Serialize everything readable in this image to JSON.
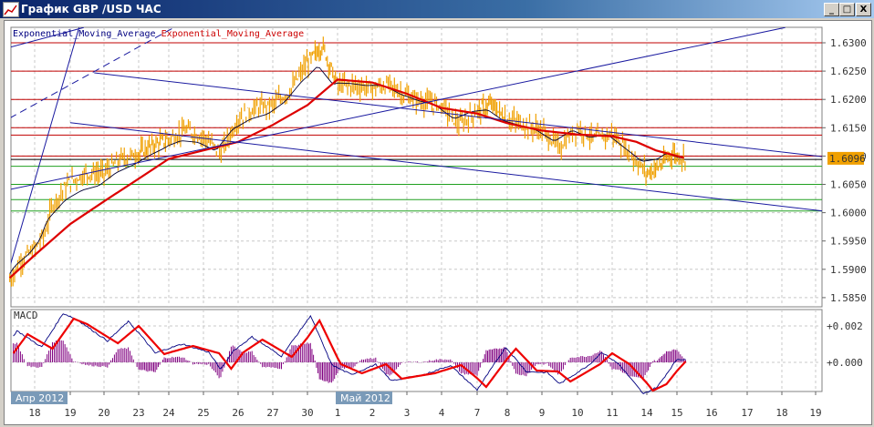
{
  "window": {
    "title": "График GBP /USD  ЧАС",
    "minimize": "_",
    "maximize": "□",
    "close": "X"
  },
  "legend": [
    {
      "label": "Exponential_Moving_Average",
      "color": "#000080"
    },
    {
      "label": "Exponential_Moving_Average",
      "color": "#cc0000"
    }
  ],
  "macd_label": "MACD",
  "current_price_label": "1.6096",
  "chart_data": {
    "type": "line",
    "title": "График GBP /USD  ЧАС",
    "x_ticks": [
      "18",
      "19",
      "20",
      "23",
      "24",
      "25",
      "26",
      "27",
      "30",
      "1",
      "2",
      "3",
      "4",
      "7",
      "8",
      "9",
      "10",
      "11",
      "14",
      "15",
      "16",
      "17",
      "18",
      "19"
    ],
    "month_labels": [
      {
        "label": "Апр 2012",
        "at_index": -0.7
      },
      {
        "label": "Май 2012",
        "at_index": 9
      }
    ],
    "price_axis": {
      "ticks": [
        "1.6300",
        "1.6250",
        "1.6200",
        "1.6150",
        "1.6100",
        "1.6050",
        "1.6000",
        "1.5950",
        "1.5900",
        "1.5850"
      ],
      "ylim": [
        1.5825,
        1.6325
      ]
    },
    "macd_axis": {
      "ticks": [
        "+0.002",
        "+0.000"
      ],
      "ylim": [
        -0.002,
        0.0027
      ]
    },
    "current_price": 1.6096,
    "price_series": {
      "name": "GBP/USD close",
      "color": "#f0a000",
      "points": [
        [
          -0.7,
          1.588
        ],
        [
          -0.4,
          1.5915
        ],
        [
          0,
          1.5935
        ],
        [
          0.3,
          1.5965
        ],
        [
          0.5,
          1.6015
        ],
        [
          1,
          1.6055
        ],
        [
          1.5,
          1.607
        ],
        [
          2,
          1.607
        ],
        [
          2.5,
          1.6095
        ],
        [
          3,
          1.6105
        ],
        [
          3.5,
          1.612
        ],
        [
          4,
          1.613
        ],
        [
          4.5,
          1.6145
        ],
        [
          5,
          1.6135
        ],
        [
          5.5,
          1.6105
        ],
        [
          6,
          1.6165
        ],
        [
          6.5,
          1.6185
        ],
        [
          7,
          1.619
        ],
        [
          7.5,
          1.6215
        ],
        [
          8,
          1.6265
        ],
        [
          8.5,
          1.6295
        ],
        [
          9,
          1.6225
        ],
        [
          9.5,
          1.6225
        ],
        [
          10,
          1.622
        ],
        [
          10.5,
          1.6225
        ],
        [
          11,
          1.6205
        ],
        [
          11.5,
          1.6195
        ],
        [
          12,
          1.619
        ],
        [
          12.5,
          1.6155
        ],
        [
          13,
          1.618
        ],
        [
          13.5,
          1.619
        ],
        [
          14,
          1.6165
        ],
        [
          14.5,
          1.6155
        ],
        [
          15,
          1.6145
        ],
        [
          15.5,
          1.6115
        ],
        [
          16,
          1.615
        ],
        [
          16.5,
          1.613
        ],
        [
          17,
          1.614
        ],
        [
          17.5,
          1.6105
        ],
        [
          18,
          1.607
        ],
        [
          18.5,
          1.6085
        ],
        [
          18.8,
          1.6105
        ],
        [
          19.2,
          1.6096
        ]
      ]
    },
    "ema_series": {
      "name": "Exponential_Moving_Average",
      "color": "#dd0000",
      "points": [
        [
          -0.7,
          1.5885
        ],
        [
          0,
          1.5925
        ],
        [
          1,
          1.598
        ],
        [
          2,
          1.602
        ],
        [
          3,
          1.606
        ],
        [
          4,
          1.6095
        ],
        [
          5,
          1.611
        ],
        [
          6,
          1.6125
        ],
        [
          7,
          1.6155
        ],
        [
          8,
          1.619
        ],
        [
          9,
          1.6235
        ],
        [
          10,
          1.623
        ],
        [
          11,
          1.621
        ],
        [
          12,
          1.6185
        ],
        [
          13,
          1.6175
        ],
        [
          14,
          1.6158
        ],
        [
          15,
          1.6145
        ],
        [
          16,
          1.6138
        ],
        [
          17,
          1.6135
        ],
        [
          17.7,
          1.6125
        ],
        [
          18.3,
          1.611
        ],
        [
          19.2,
          1.6097
        ]
      ]
    },
    "hlines": [
      {
        "price": 1.63,
        "color": "#c00000"
      },
      {
        "price": 1.625,
        "color": "#c00000"
      },
      {
        "price": 1.62,
        "color": "#c00000"
      },
      {
        "price": 1.615,
        "color": "#c00000"
      },
      {
        "price": 1.6137,
        "color": "#c00000"
      },
      {
        "price": 1.61,
        "color": "#c00000"
      },
      {
        "price": 1.6094,
        "color": "#000000"
      },
      {
        "price": 1.6082,
        "color": "#20a020"
      },
      {
        "price": 1.605,
        "color": "#20a020"
      },
      {
        "price": 1.6023,
        "color": "#20a020"
      },
      {
        "price": 1.6003,
        "color": "#20a020"
      }
    ],
    "trendlines": [
      {
        "from": [
          -0.7,
          1.6041
        ],
        "to": [
          22.1,
          1.6327
        ],
        "dashed": false
      },
      {
        "from": [
          1.71,
          1.6247
        ],
        "to": [
          23.2,
          1.6099
        ],
        "dashed": false
      },
      {
        "from": [
          1.0,
          1.6159
        ],
        "to": [
          23.2,
          1.6003
        ],
        "dashed": false
      },
      {
        "from": [
          -0.7,
          1.5904
        ],
        "to": [
          1.26,
          1.6327
        ],
        "dashed": false
      },
      {
        "from": [
          -0.7,
          1.6167
        ],
        "to": [
          4.15,
          1.6327
        ],
        "dashed": true
      },
      {
        "from": [
          -0.7,
          1.6292
        ],
        "to": [
          1.4,
          1.6327
        ],
        "dashed": false
      }
    ],
    "macd_signal": {
      "name": "Signal",
      "color": "#ee0000",
      "points": [
        [
          -0.6,
          0.0005
        ],
        [
          -0.2,
          0.00155
        ],
        [
          0.5,
          0.00075
        ],
        [
          1.1,
          0.0024
        ],
        [
          1.5,
          0.0021
        ],
        [
          2.4,
          0.00105
        ],
        [
          3,
          0.002
        ],
        [
          3.85,
          0.00045
        ],
        [
          4.7,
          0.0009
        ],
        [
          5.45,
          0.0005
        ],
        [
          5.8,
          -0.00035
        ],
        [
          6.15,
          0.00055
        ],
        [
          6.7,
          0.00125
        ],
        [
          7.55,
          0.0003
        ],
        [
          8.4,
          0.0023
        ],
        [
          9.1,
          -0.0001
        ],
        [
          9.7,
          -0.0006
        ],
        [
          10.4,
          -0.0001
        ],
        [
          10.85,
          -0.0009
        ],
        [
          11.8,
          -0.0006
        ],
        [
          12.55,
          -0.00015
        ],
        [
          13.3,
          -0.00135
        ],
        [
          14.25,
          0.00075
        ],
        [
          14.85,
          -0.00045
        ],
        [
          15.45,
          -0.0005
        ],
        [
          15.8,
          -0.00105
        ],
        [
          16.65,
          -0.0001
        ],
        [
          17,
          0.0005
        ],
        [
          17.5,
          -0.0001
        ],
        [
          18.2,
          -0.00155
        ],
        [
          18.65,
          -0.0012
        ],
        [
          19.3,
          0.00015
        ]
      ]
    },
    "macd_line": {
      "name": "MACD",
      "color": "#000080"
    },
    "macd_histogram": {
      "name": "Histogram",
      "color": "#800080"
    }
  }
}
